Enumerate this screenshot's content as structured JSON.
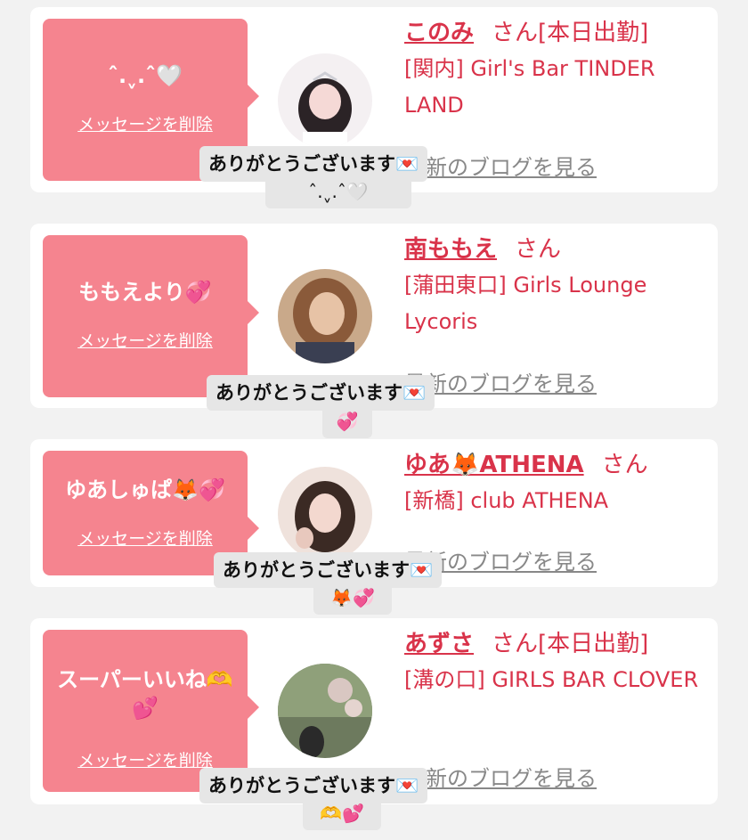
{
  "items": [
    {
      "bubble_message": "ˆ.ˬ.ˆ🤍",
      "delete_label": "メッセージを削除",
      "name": "このみ",
      "suffix": "さん",
      "shift": "[本日出勤]",
      "shop": "[関内] Girl's Bar TINDER LAND",
      "blog_label": "最新のブログを見る",
      "reply": "ありがとうございます💌",
      "reply_extra": "ˆ.ˬ.ˆ🤍",
      "avatar_colors": [
        "#f4f0f2",
        "#2b2326",
        "#f5d9d6"
      ]
    },
    {
      "bubble_message": "ももえより💞",
      "delete_label": "メッセージを削除",
      "name": "南ももえ",
      "suffix": "さん",
      "shift": "",
      "shop": "[蒲田東口] Girls Lounge Lycoris",
      "blog_label": "最新のブログを見る",
      "reply": "ありがとうございます💌",
      "reply_extra": "💞",
      "avatar_colors": [
        "#c9a98a",
        "#8a5a3a",
        "#3a3f52"
      ]
    },
    {
      "bubble_message": "ゆあしゅぱ🦊💞",
      "delete_label": "メッセージを削除",
      "name": "ゆあ🦊ATHENA",
      "suffix": "さん",
      "shift": "",
      "shop": "[新橋] club ATHENA",
      "blog_label": "最新のブログを見る",
      "reply": "ありがとうございます💌",
      "reply_extra": "🦊💞",
      "avatar_colors": [
        "#efe2dc",
        "#3b2a24",
        "#c9b2a8"
      ]
    },
    {
      "bubble_message": "スーパーいいね🫶💕",
      "delete_label": "メッセージを削除",
      "name": "あずさ",
      "suffix": "さん",
      "shift": "[本日出勤]",
      "shop": "[溝の口] GIRLS BAR CLOVER",
      "blog_label": "最新のブログを見る",
      "reply": "ありがとうございます💌",
      "reply_extra": "🫶💕",
      "avatar_colors": [
        "#6d7a5e",
        "#d9c7c2",
        "#2a2a2a"
      ]
    }
  ],
  "colors": {
    "background": "#f2f2f2",
    "card": "#ffffff",
    "bubble": "#f5848f",
    "accent_red": "#d9334a",
    "blog_gray": "#888888",
    "reply_bg": "#e6e6e6"
  }
}
